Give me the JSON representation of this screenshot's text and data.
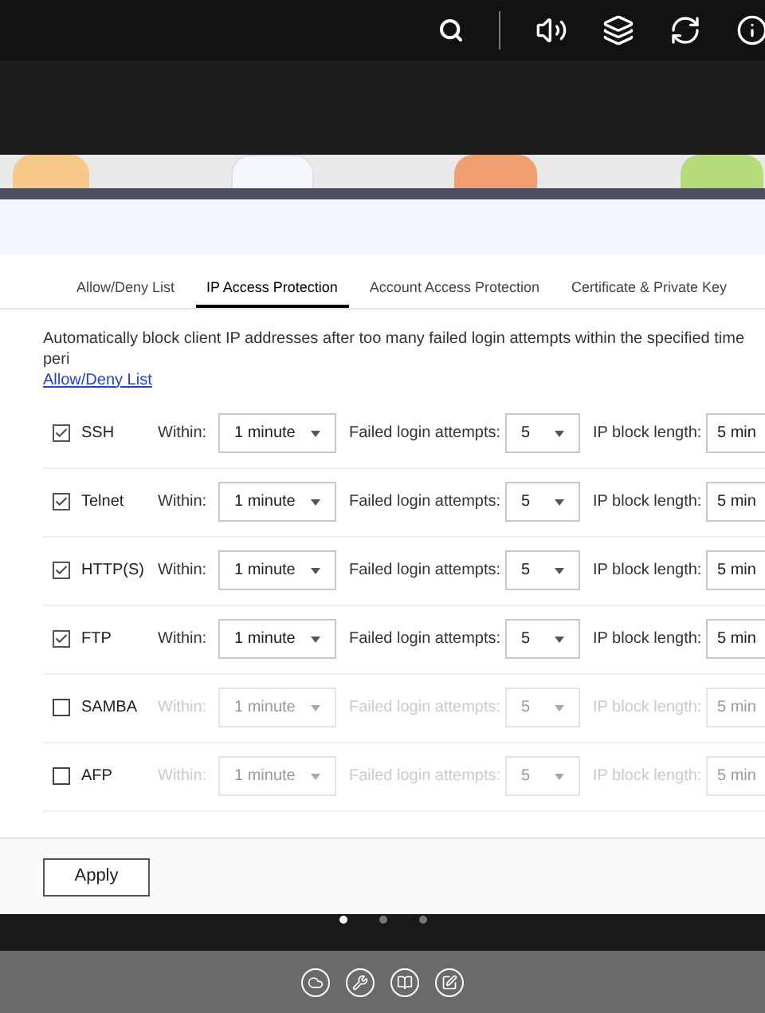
{
  "tabs": [
    {
      "label": "Allow/Deny List",
      "selected": false
    },
    {
      "label": "IP Access Protection",
      "selected": true
    },
    {
      "label": "Account Access Protection",
      "selected": false
    },
    {
      "label": "Certificate & Private Key",
      "selected": false
    }
  ],
  "description": "Automatically block client IP addresses after too many failed login attempts within the specified time peri",
  "link": "Allow/Deny List",
  "services": [
    {
      "name": "SSH",
      "checked": true,
      "within_label": "Within:",
      "within": "1 minute",
      "attempts_label": "Failed login attempts:",
      "attempts": "5",
      "block_label": "IP block length:",
      "block": "5 min"
    },
    {
      "name": "Telnet",
      "checked": true,
      "within_label": "Within:",
      "within": "1 minute",
      "attempts_label": "Failed login attempts:",
      "attempts": "5",
      "block_label": "IP block length:",
      "block": "5 min"
    },
    {
      "name": "HTTP(S)",
      "checked": true,
      "within_label": "Within:",
      "within": "1 minute",
      "attempts_label": "Failed login attempts:",
      "attempts": "5",
      "block_label": "IP block length:",
      "block": "5 min"
    },
    {
      "name": "FTP",
      "checked": true,
      "within_label": "Within:",
      "within": "1 minute",
      "attempts_label": "Failed login attempts:",
      "attempts": "5",
      "block_label": "IP block length:",
      "block": "5 min"
    },
    {
      "name": "SAMBA",
      "checked": false,
      "within_label": "Within:",
      "within": "1 minute",
      "attempts_label": "Failed login attempts:",
      "attempts": "5",
      "block_label": "IP block length:",
      "block": "5 min"
    },
    {
      "name": "AFP",
      "checked": false,
      "within_label": "Within:",
      "within": "1 minute",
      "attempts_label": "Failed login attempts:",
      "attempts": "5",
      "block_label": "IP block length:",
      "block": "5 min"
    }
  ],
  "apply_button": "Apply",
  "pages": [
    {
      "selected": true
    },
    {
      "selected": false
    },
    {
      "selected": false
    }
  ]
}
